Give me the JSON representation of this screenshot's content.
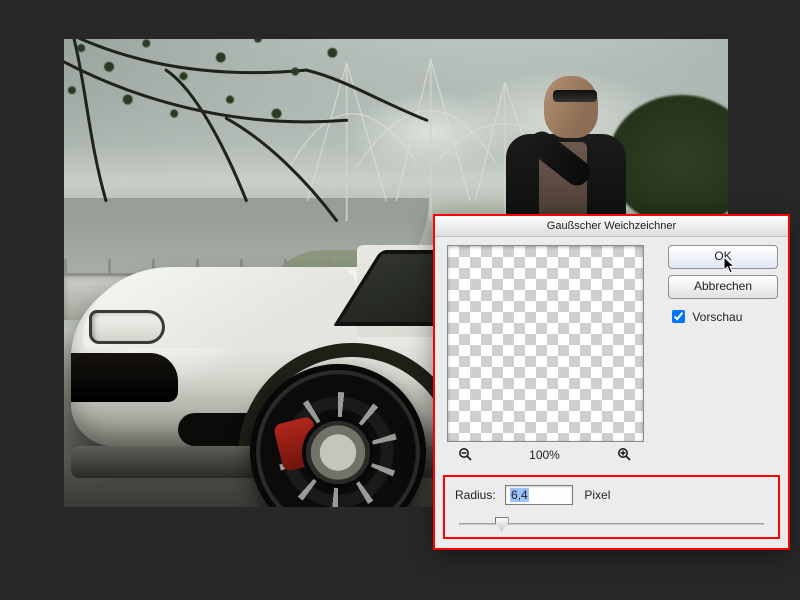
{
  "dialog": {
    "title": "Gaußscher Weichzeichner",
    "ok": "OK",
    "cancel": "Abbrechen",
    "preview_label": "Vorschau",
    "preview_checked": true,
    "zoom": "100%",
    "radius_label": "Radius:",
    "radius_value": "6,4",
    "radius_unit": "Pixel",
    "slider_percent": 14
  },
  "highlight_color": "#ff0000"
}
